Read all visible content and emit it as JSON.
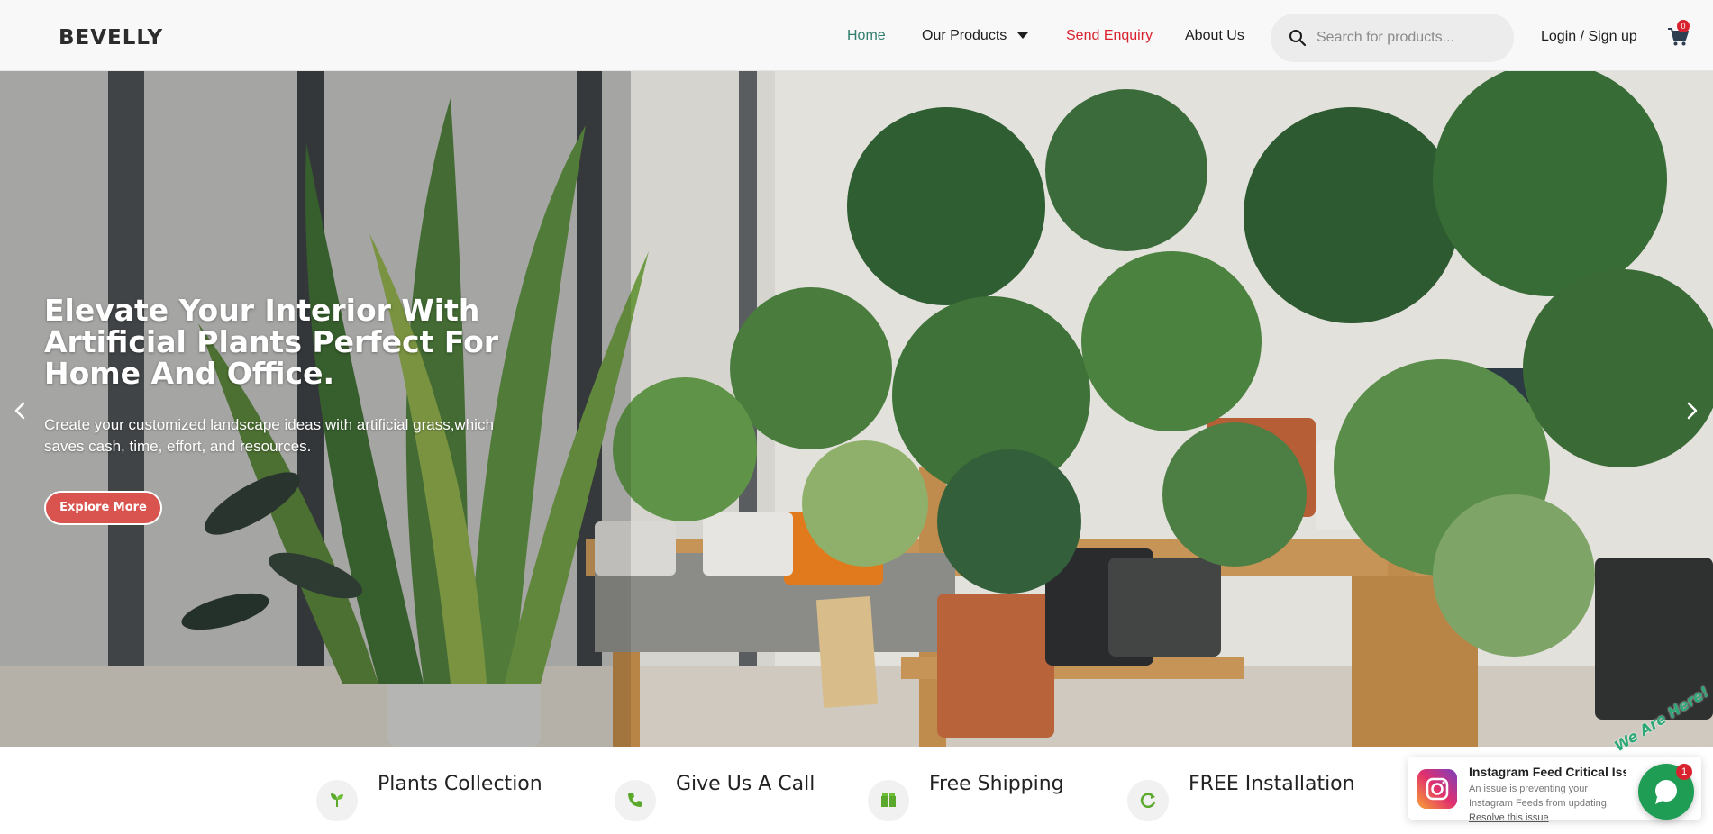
{
  "brand": {
    "logo": "BEVELLY",
    "accent_color": "#2f7d6d",
    "highlight_color": "#d8232f"
  },
  "nav": {
    "home": "Home",
    "products": "Our Products",
    "enquiry": "Send Enquiry",
    "about": "About Us",
    "login": "Login / Sign up"
  },
  "search": {
    "placeholder": "Search for products..."
  },
  "cart": {
    "count": "0"
  },
  "hero": {
    "title": "Elevate Your Interior With Artificial Plants Perfect For Home And Office.",
    "subtitle": "Create your customized landscape ideas with artificial grass,which saves cash, time, effort, and resources.",
    "button": "Explore More"
  },
  "features": [
    {
      "title": "Plants Collection",
      "icon": "sprout-icon"
    },
    {
      "title": "Give Us A Call",
      "icon": "phone-icon"
    },
    {
      "title": "Free Shipping",
      "icon": "box-icon"
    },
    {
      "title": "FREE Installation",
      "icon": "refresh-icon"
    }
  ],
  "instagram_notice": {
    "title": "Instagram Feed Critical Issues",
    "message": "An issue is preventing your Instagram Feeds from updating.",
    "link": "Resolve this issue"
  },
  "chat": {
    "tagline": "We Are Here!",
    "badge": "1"
  }
}
